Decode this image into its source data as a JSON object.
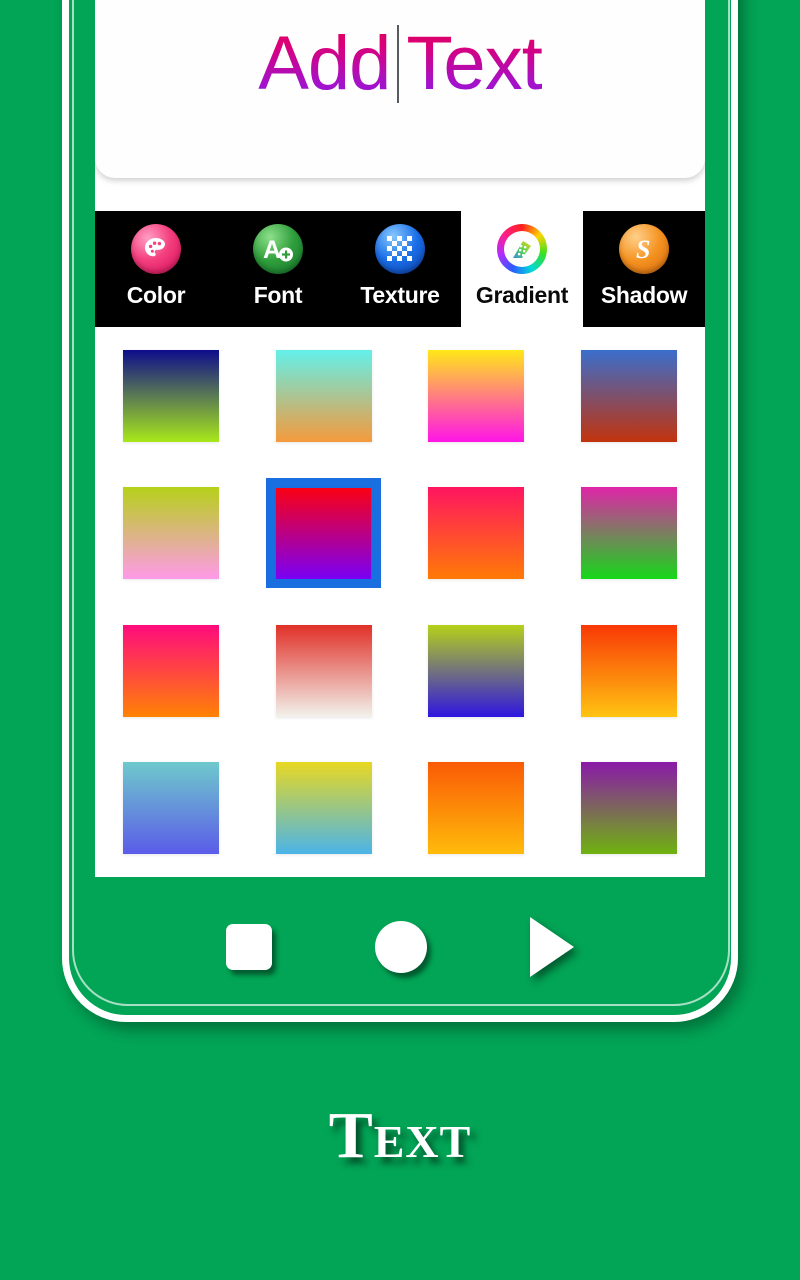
{
  "theme": {
    "background_green": "#02a455",
    "selection_blue": "#1a6fe0",
    "tabbar_black": "#000000",
    "screen_white": "#ffffff"
  },
  "preview": {
    "word_left": "Add",
    "word_right": "Text",
    "caret": "|",
    "gradient_top": "#e3004d",
    "gradient_bottom": "#8b17e0"
  },
  "tabs": [
    {
      "label": "Color",
      "icon": "palette-icon",
      "active": false
    },
    {
      "label": "Font",
      "icon": "font-a-plus-icon",
      "active": false
    },
    {
      "label": "Texture",
      "icon": "checkerboard-icon",
      "active": false
    },
    {
      "label": "Gradient",
      "icon": "color-wheel-icon",
      "active": true
    },
    {
      "label": "Shadow",
      "icon": "s-shadow-icon",
      "active": false
    }
  ],
  "gradient_swatches": {
    "columns": 4,
    "rows": 4,
    "selected_index": 5,
    "items": [
      {
        "index": 0,
        "from": "#0d0d8c",
        "to": "#a8e81a",
        "name": "navy-to-lime"
      },
      {
        "index": 1,
        "from": "#63f0ea",
        "to": "#f59a3c",
        "name": "cyan-to-orange"
      },
      {
        "index": 2,
        "from": "#ffe818",
        "to": "#ff15e8",
        "name": "yellow-to-magenta"
      },
      {
        "index": 3,
        "from": "#3a6ecc",
        "to": "#c2330c",
        "name": "blue-to-rust"
      },
      {
        "index": 4,
        "from": "#b6d119",
        "to": "#ff9ae8",
        "name": "lime-to-pink"
      },
      {
        "index": 5,
        "from": "#fa0013",
        "to": "#7a00f5",
        "name": "red-to-violet"
      },
      {
        "index": 6,
        "from": "#ff1560",
        "to": "#ff7a06",
        "name": "pink-to-orange"
      },
      {
        "index": 7,
        "from": "#e024a8",
        "to": "#16d819",
        "name": "magenta-to-green"
      },
      {
        "index": 8,
        "from": "#ff0b7d",
        "to": "#ff8205",
        "name": "magenta-to-amber"
      },
      {
        "index": 9,
        "from": "#e03028",
        "to": "#f2f2ec",
        "name": "red-to-white"
      },
      {
        "index": 10,
        "from": "#b6d119",
        "to": "#2e15e0",
        "name": "lime-to-blue"
      },
      {
        "index": 11,
        "from": "#f93806",
        "to": "#ffc412",
        "name": "redorange-to-gold"
      },
      {
        "index": 12,
        "from": "#6fc9cc",
        "to": "#5b5ce8",
        "name": "teal-to-indigo"
      },
      {
        "index": 13,
        "from": "#e8d823",
        "to": "#4bb4e8",
        "name": "yellow-to-sky"
      },
      {
        "index": 14,
        "from": "#fa5a06",
        "to": "#ffbb0a",
        "name": "orange-to-gold"
      },
      {
        "index": 15,
        "from": "#8a19a8",
        "to": "#6fb310",
        "name": "purple-to-green"
      }
    ]
  },
  "nav_bar": {
    "recents_label": "Recents",
    "home_label": "Home",
    "back_label": "Back"
  },
  "caption": {
    "text": "Text"
  }
}
